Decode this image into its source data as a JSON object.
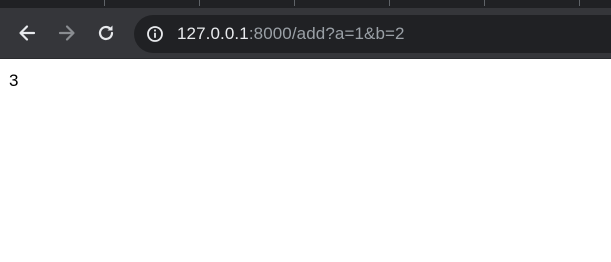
{
  "browser": {
    "toolbar": {
      "back_icon": "arrow-left-icon",
      "forward_icon": "arrow-right-icon",
      "reload_icon": "reload-icon"
    },
    "address_bar": {
      "site_info_icon": "info-circle-icon",
      "url_host": "127.0.0.1",
      "url_rest": ":8000/add?a=1&b=2"
    }
  },
  "page": {
    "body_text": "3"
  },
  "colors": {
    "tabstrip": "#202124",
    "toolbar": "#35363a",
    "omnibox": "#202124",
    "url_host": "#e8eaed",
    "url_rest": "#9aa0a6",
    "page_background": "#ffffff"
  }
}
